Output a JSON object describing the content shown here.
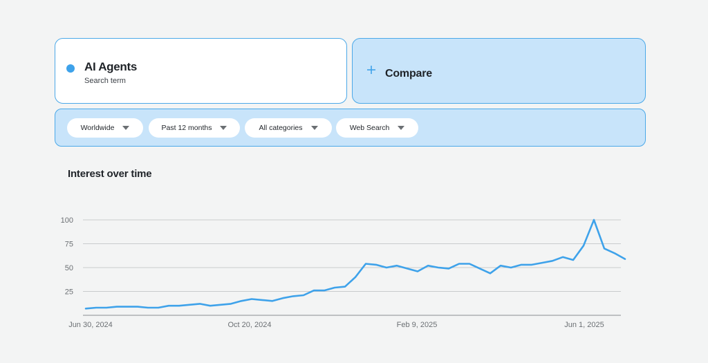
{
  "search_term": {
    "name": "AI Agents",
    "type": "Search term",
    "color": "#3ea2ea"
  },
  "compare": {
    "label": "Compare",
    "icon": "plus-icon"
  },
  "filters": {
    "region": "Worldwide",
    "time_range": "Past 12 months",
    "category": "All categories",
    "search_type": "Web Search"
  },
  "chart": {
    "title": "Interest over time"
  },
  "chart_data": {
    "type": "line",
    "title": "Interest over time",
    "xlabel": "",
    "ylabel": "",
    "ylim": [
      0,
      100
    ],
    "yticks": [
      25,
      50,
      75,
      100
    ],
    "xtick_labels": [
      "Jun 30, 2024",
      "Oct 20, 2024",
      "Feb 9, 2025",
      "Jun 1, 2025"
    ],
    "grid": true,
    "series_color": "#3ea2ea",
    "series": [
      {
        "values": [
          7,
          8,
          8,
          9,
          9,
          9,
          8,
          8,
          10,
          10,
          11,
          12,
          10,
          11,
          12,
          15,
          17,
          16,
          15,
          18,
          20,
          21,
          26,
          26,
          29,
          30,
          40,
          54,
          53,
          50,
          52,
          49,
          46,
          52,
          50,
          49,
          54,
          54,
          49,
          44,
          52,
          50,
          53,
          53,
          55,
          57,
          61,
          58,
          73,
          100,
          70,
          65,
          59
        ]
      }
    ]
  }
}
